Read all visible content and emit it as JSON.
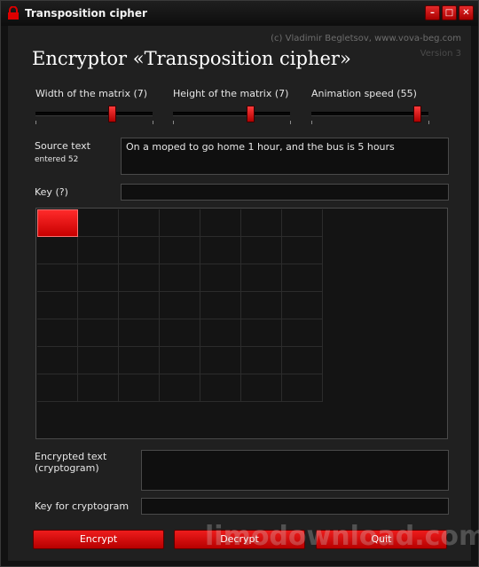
{
  "window": {
    "title": "Transposition cipher",
    "minimize_glyph": "–",
    "maximize_glyph": "□",
    "close_glyph": "✕"
  },
  "header": {
    "copyright": "(c) Vladimir Begletsov, www.vova-beg.com",
    "version": "Version 3",
    "heading": "Encryptor «Transposition cipher»"
  },
  "sliders": [
    {
      "label": "Width of the matrix (7)",
      "level": 0.65
    },
    {
      "label": "Height of the matrix (7)",
      "level": 0.66
    },
    {
      "label": "Animation speed (55)",
      "level": 0.9
    }
  ],
  "source": {
    "label": "Source text",
    "count_text": "entered 52",
    "value": "On a moped to go home 1 hour, and the bus is 5 hours"
  },
  "key": {
    "label": "Key (?)",
    "value": ""
  },
  "matrix": {
    "cols": 7,
    "rows": 7,
    "active_cell": [
      0,
      0
    ]
  },
  "encrypted": {
    "label_line1": "Encrypted text",
    "label_line2": "(cryptogram)",
    "value": ""
  },
  "cryptogram_key": {
    "label": "Key for cryptogram",
    "value": ""
  },
  "buttons": {
    "encrypt": "Encrypt",
    "decrypt": "Decrypt",
    "quit": "Quit"
  },
  "watermark": "limodownload.com",
  "colors": {
    "accent": "#d40000",
    "background": "#202020"
  },
  "icons": {
    "app": "lock-icon"
  }
}
